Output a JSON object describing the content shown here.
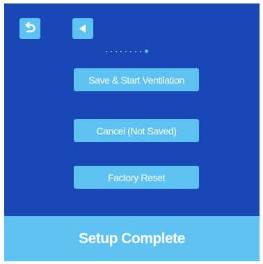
{
  "header": {
    "back_icon": "undo-arrow-icon",
    "prev_icon": "triangle-left-icon"
  },
  "pagination": {
    "total": 9,
    "current": 9
  },
  "actions": {
    "save_label": "Save & Start Ventilation",
    "cancel_label": "Cancel (Not Saved)",
    "reset_label": "Factory Reset"
  },
  "footer": {
    "title": "Setup Complete"
  },
  "colors": {
    "background": "#1947b5",
    "accent": "#5ec3f2",
    "text": "#ffffff"
  }
}
